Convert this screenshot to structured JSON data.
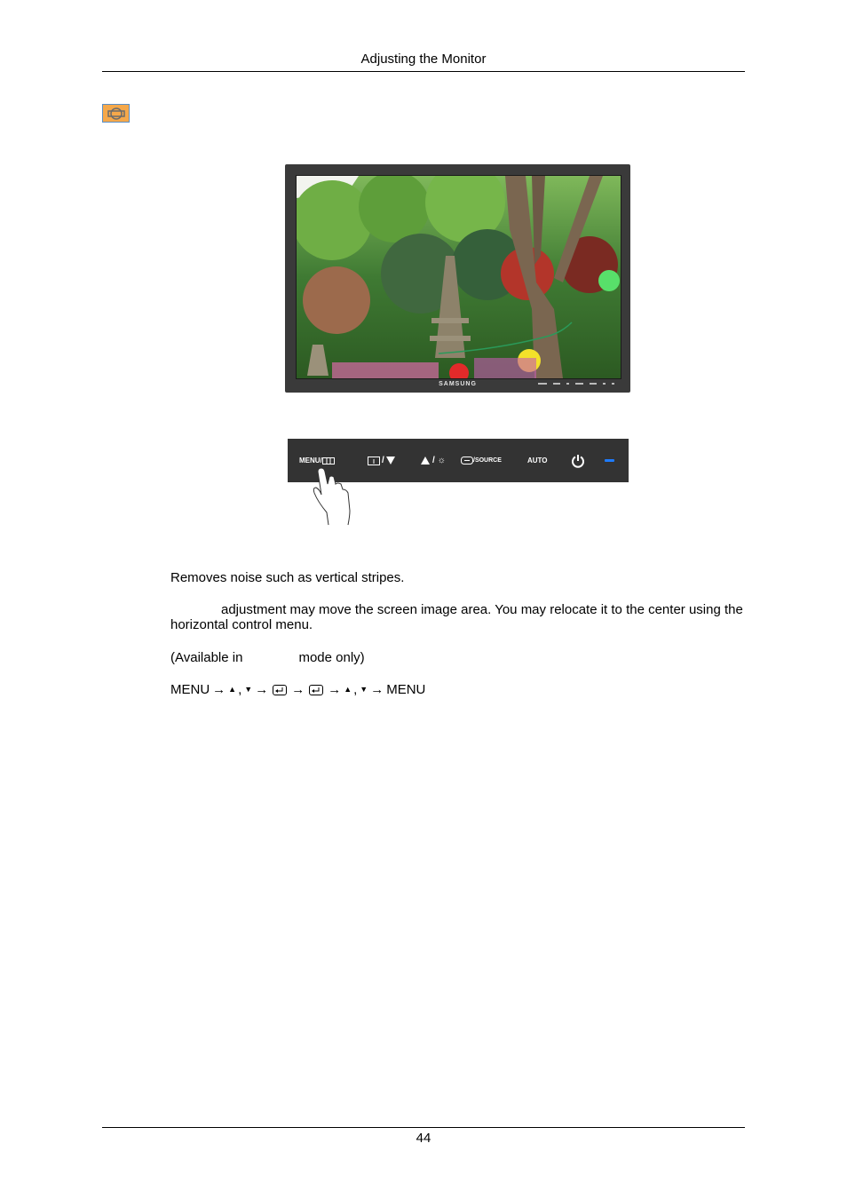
{
  "header": {
    "title": "Adjusting the Monitor"
  },
  "section_icon": {
    "name": "fine-tuning-icon",
    "bg_color": "#f5a84a",
    "border_color": "#5b8fc6"
  },
  "monitor_illustration": {
    "brand": "SAMSUNG",
    "screen_content": "garden with stone pagodas, trees and lanterns"
  },
  "control_panel": {
    "buttons": [
      {
        "label": "MENU/",
        "icon": "menu-grid-icon"
      },
      {
        "label": "/",
        "icon": "input-down-icon"
      },
      {
        "label": "/",
        "icon": "up-brightness-icon"
      },
      {
        "label": "/SOURCE",
        "icon": "enter-source-icon"
      },
      {
        "label": "AUTO",
        "icon": ""
      },
      {
        "label": "",
        "icon": "power-icon"
      },
      {
        "label": "",
        "icon": "power-indicator-led"
      }
    ],
    "led_color": "#1e7bff"
  },
  "body": {
    "description": "Removes noise such as vertical stripes.",
    "note": "adjustment may move the screen image area. You may relocate it to the center using the horizontal control menu.",
    "availability_prefix": "(Available in",
    "availability_suffix": "mode only)",
    "sequence": {
      "menu_start": "MENU",
      "arrow": "→",
      "up": "▲",
      "comma": ",",
      "down": "▼",
      "menu_end": "MENU"
    }
  },
  "footer": {
    "page_number": "44"
  }
}
